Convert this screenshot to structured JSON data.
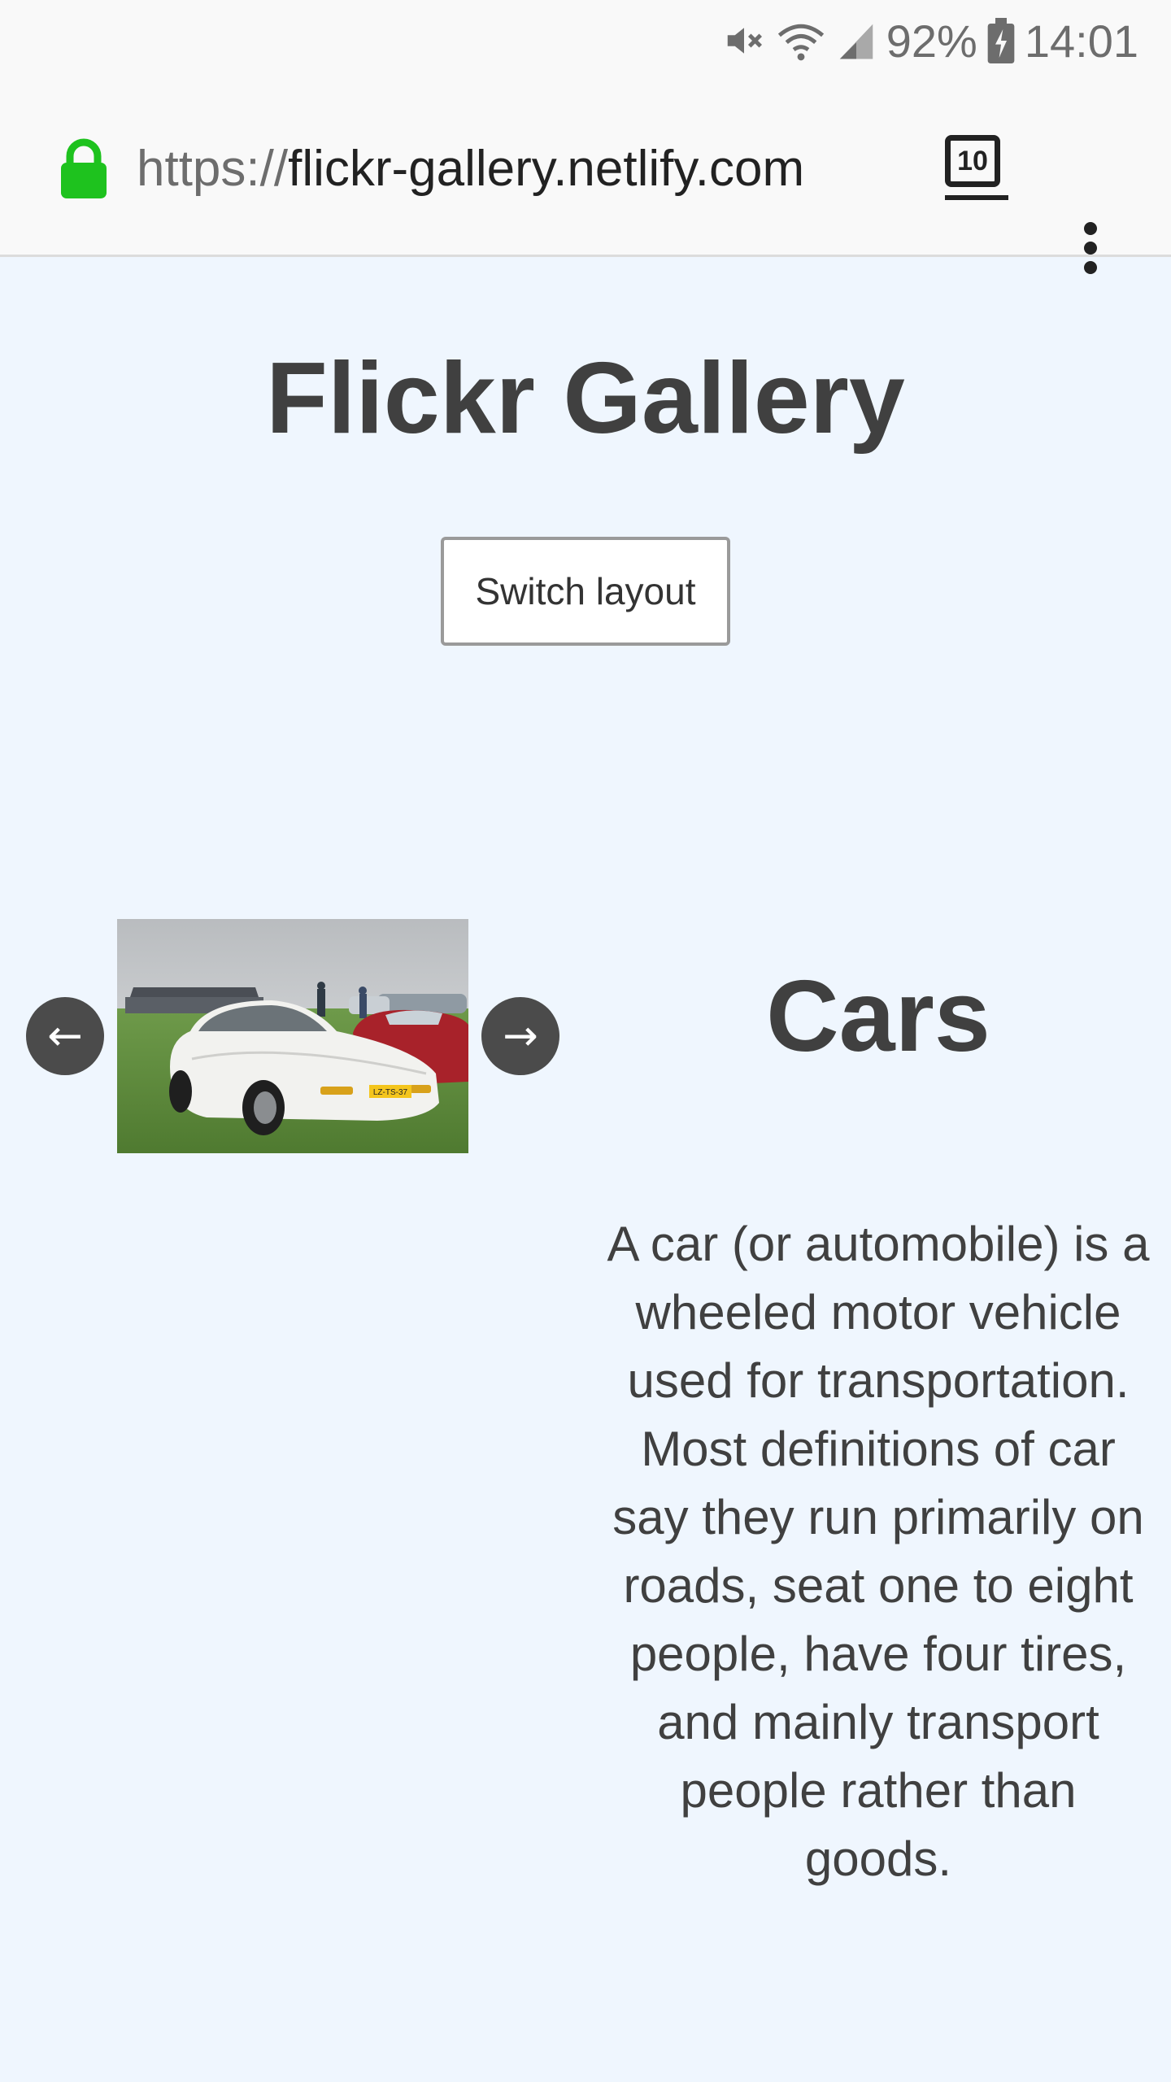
{
  "status_bar": {
    "battery_percent": "92%",
    "time": "14:01",
    "icons": [
      "mute-icon",
      "wifi-icon",
      "signal-icon",
      "battery-charging-icon"
    ]
  },
  "browser": {
    "url_scheme": "https://",
    "url_host": "flickr-gallery.netlify.com",
    "tab_count": "10",
    "icons": [
      "lock-icon",
      "tabs-icon",
      "more-vert-icon"
    ],
    "lock_color": "#1ec21e"
  },
  "page": {
    "title": "Flickr Gallery",
    "switch_layout_label": "Switch layout",
    "prev_label": "←",
    "next_label": "→",
    "category": {
      "title": "Cars",
      "description": "A car (or automobile) is a wheeled motor vehicle used for transportation. Most definitions of car say they run primarily on roads, seat one to eight people, have four tires, and mainly transport people rather than goods.",
      "photo_plate": "LZ-TS-37"
    }
  },
  "colors": {
    "page_background": "#eff6fe",
    "text": "#404040",
    "arrow_button": "#4b4b4b"
  }
}
